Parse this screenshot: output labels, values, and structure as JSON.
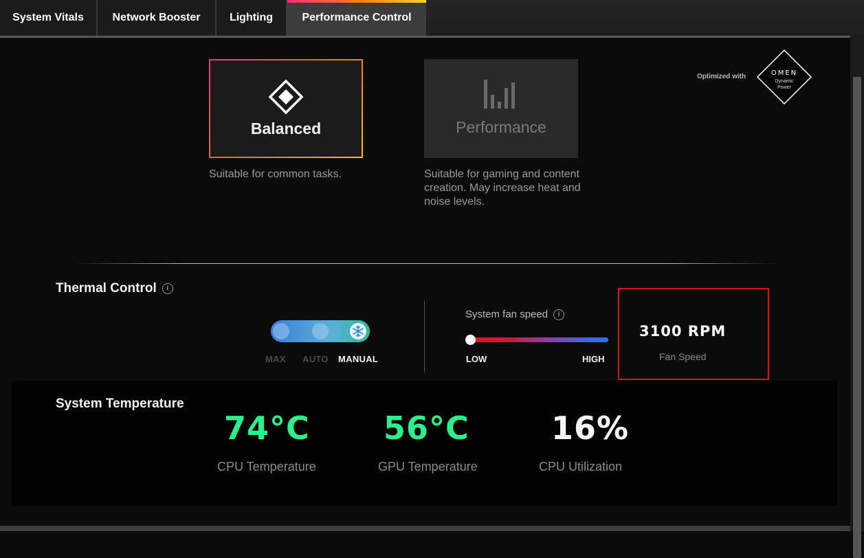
{
  "tabs": [
    {
      "label": "System Vitals"
    },
    {
      "label": "Network Booster"
    },
    {
      "label": "Lighting"
    },
    {
      "label": "Performance Control"
    }
  ],
  "modes": {
    "balanced": {
      "label": "Balanced",
      "description": "Suitable for common tasks.",
      "icon": "diamond-icon"
    },
    "performance": {
      "label": "Performance",
      "description": "Suitable for gaming and content creation. May increase heat and noise levels.",
      "icon": "bars-icon"
    }
  },
  "omen": {
    "optimized_text": "Optimized with",
    "logo_brand": "OMEN",
    "logo_line1": "Dynamic",
    "logo_line2": "Power"
  },
  "thermal": {
    "title": "Thermal Control",
    "modes": [
      "MAX",
      "AUTO",
      "MANUAL"
    ],
    "selected_mode": "MANUAL",
    "fan_label": "System fan speed",
    "low_label": "LOW",
    "high_label": "HIGH",
    "fan_slider_value": 0.0,
    "rpm_value": "3100 RPM",
    "rpm_caption": "Fan Speed"
  },
  "system_temperature": {
    "title": "System Temperature",
    "cpu_temp": "74°C",
    "cpu_temp_label": "CPU Temperature",
    "gpu_temp": "56°C",
    "gpu_temp_label": "GPU Temperature",
    "cpu_util": "16%",
    "cpu_util_label": "CPU Utilization"
  },
  "colors": {
    "accent_green": "#2cf08c",
    "highlight_red": "#e01010",
    "tab_gradient_start": "#ff2d7a",
    "tab_gradient_end": "#ffcf2a"
  }
}
